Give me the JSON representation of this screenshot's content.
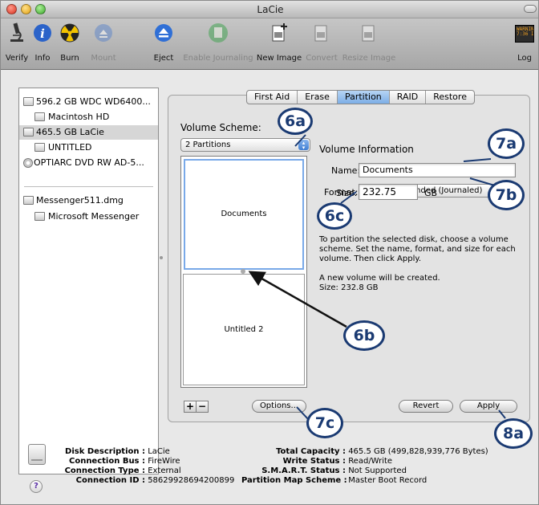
{
  "window": {
    "title": "LaCie"
  },
  "toolbar": {
    "items": [
      {
        "label": "Verify",
        "icon": "microscope-icon",
        "enabled": true
      },
      {
        "label": "Info",
        "icon": "info-icon",
        "enabled": true
      },
      {
        "label": "Burn",
        "icon": "burn-icon",
        "enabled": true
      },
      {
        "label": "Mount",
        "icon": "mount-icon",
        "enabled": false
      },
      {
        "label": "Eject",
        "icon": "eject-icon",
        "enabled": true
      },
      {
        "label": "Enable Journaling",
        "icon": "journaling-icon",
        "enabled": false
      },
      {
        "label": "New Image",
        "icon": "new-image-icon",
        "enabled": true
      },
      {
        "label": "Convert",
        "icon": "convert-icon",
        "enabled": false
      },
      {
        "label": "Resize Image",
        "icon": "resize-image-icon",
        "enabled": false
      }
    ],
    "log_label": "Log",
    "log_icon_text": "WARNIN\n7:36 I"
  },
  "sidebar": {
    "items": [
      {
        "label": "596.2 GB WDC WD6400...",
        "indent": 0,
        "icon": "hard-drive-icon"
      },
      {
        "label": "Macintosh HD",
        "indent": 1,
        "icon": "volume-icon"
      },
      {
        "label": "465.5 GB LaCie",
        "indent": 0,
        "icon": "external-drive-icon",
        "selected": true
      },
      {
        "label": "UNTITLED",
        "indent": 1,
        "icon": "volume-icon"
      },
      {
        "label": "OPTIARC DVD RW AD-5...",
        "indent": 0,
        "icon": "optical-disc-icon"
      },
      {
        "label": "Messenger511.dmg",
        "indent": 0,
        "icon": "disk-image-icon"
      },
      {
        "label": "Microsoft Messenger",
        "indent": 1,
        "icon": "volume-icon"
      }
    ]
  },
  "tabs": [
    {
      "label": "First Aid"
    },
    {
      "label": "Erase"
    },
    {
      "label": "Partition",
      "active": true
    },
    {
      "label": "RAID"
    },
    {
      "label": "Restore"
    }
  ],
  "partition": {
    "volume_scheme_label": "Volume Scheme:",
    "scheme_value": "2 Partitions",
    "partitions": [
      "Documents",
      "Untitled 2"
    ],
    "volume_info_label": "Volume Information",
    "name_label": "Name:",
    "name_value": "Documents",
    "format_label": "Format:",
    "format_value": "Mac OS Extended (Journaled)",
    "size_label": "Size:",
    "size_value": "232.75",
    "size_unit": "GB",
    "help_text": "To partition the selected disk, choose a volume scheme. Set the name, format, and size for each volume. Then click Apply.",
    "status_line1": "A new volume will be created.",
    "status_line2": "Size: 232.8 GB",
    "add_label": "+",
    "remove_label": "−",
    "options_label": "Options...",
    "revert_label": "Revert",
    "apply_label": "Apply"
  },
  "disk_info": {
    "left": [
      {
        "key": "Disk Description :",
        "value": "LaCie"
      },
      {
        "key": "Connection Bus :",
        "value": "FireWire"
      },
      {
        "key": "Connection Type :",
        "value": "External"
      },
      {
        "key": "Connection ID :",
        "value": "58629928694200899"
      }
    ],
    "right": [
      {
        "key": "Total Capacity :",
        "value": "465.5 GB (499,828,939,776 Bytes)"
      },
      {
        "key": "Write Status :",
        "value": "Read/Write"
      },
      {
        "key": "S.M.A.R.T. Status :",
        "value": "Not Supported"
      },
      {
        "key": "Partition Map Scheme :",
        "value": "Master Boot Record"
      }
    ],
    "help_label": "?"
  },
  "callouts": {
    "c6a": "6a",
    "c7a": "7a",
    "c7b": "7b",
    "c6c": "6c",
    "c6b": "6b",
    "c7c": "7c",
    "c8a": "8a"
  },
  "colors": {
    "accent": "#1a3a72",
    "selection": "#79a9e8"
  }
}
